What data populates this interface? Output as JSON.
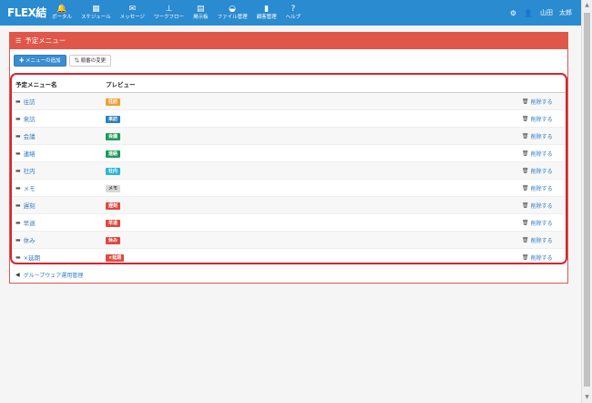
{
  "brand": "FLEX結",
  "nav": [
    {
      "icon": "bell-icon",
      "glyph": "🔔",
      "label": "ポータル"
    },
    {
      "icon": "calendar-icon",
      "glyph": "▦",
      "label": "スケジュール"
    },
    {
      "icon": "envelope-icon",
      "glyph": "✉",
      "label": "メッセージ"
    },
    {
      "icon": "stamp-icon",
      "glyph": "⊥",
      "label": "ワークフロー"
    },
    {
      "icon": "board-icon",
      "glyph": "▤",
      "label": "掲示板"
    },
    {
      "icon": "folder-icon",
      "glyph": "◒",
      "label": "ファイル管理"
    },
    {
      "icon": "book-icon",
      "glyph": "▮",
      "label": "顧客管理"
    },
    {
      "icon": "help-icon",
      "glyph": "?",
      "label": "ヘルプ"
    }
  ],
  "user": {
    "name": "山田　太郎"
  },
  "panel": {
    "title": "予定メニュー",
    "add_label": "メニューの追加",
    "reorder_label": "順番の変更"
  },
  "table": {
    "headers": {
      "name": "予定メニュー名",
      "preview": "プレビュー"
    },
    "delete_label": "削除する",
    "rows": [
      {
        "name": "往訪",
        "badge": "往訪",
        "color": "#f0a030"
      },
      {
        "name": "来訪",
        "badge": "来訪",
        "color": "#2a7fc1"
      },
      {
        "name": "会議",
        "badge": "会議",
        "color": "#1e9a55"
      },
      {
        "name": "連絡",
        "badge": "連絡",
        "color": "#1e9a55"
      },
      {
        "name": "社内",
        "badge": "社内",
        "color": "#27b7d8"
      },
      {
        "name": "メモ",
        "badge": "メモ",
        "color": "#d8d8d8",
        "text_color": "#444"
      },
      {
        "name": "遅刻",
        "badge": "遅刻",
        "color": "#e0483e"
      },
      {
        "name": "早退",
        "badge": "早退",
        "color": "#e0483e"
      },
      {
        "name": "休み",
        "badge": "休み",
        "color": "#e0483e"
      },
      {
        "name": "×延期",
        "badge": "×延期",
        "color": "#e0483e"
      }
    ]
  },
  "footer": {
    "back_label": "グループウェア運用管理"
  }
}
